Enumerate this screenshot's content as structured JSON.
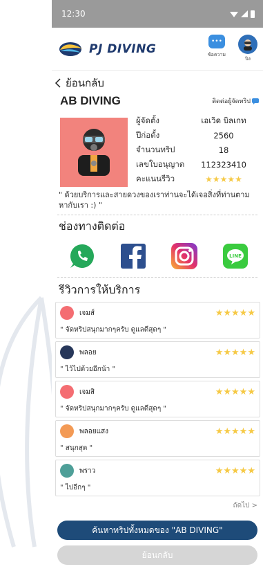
{
  "status": {
    "time": "12:30"
  },
  "app": {
    "brand": "PJ DIVING"
  },
  "header_actions": {
    "messages": "ข้อความ",
    "profile": "ปิง"
  },
  "nav": {
    "back": "ย้อนกลับ"
  },
  "company": {
    "name": "AB DIVING",
    "contact_org": "ติดต่อผู้จัดทริป",
    "fields": [
      {
        "label": "ผู้จัดตั้ง",
        "value": "เอเวิด บิลเกท"
      },
      {
        "label": "ปีก่อตั้ง",
        "value": "2560"
      },
      {
        "label": "จำนวนทริป",
        "value": "18"
      },
      {
        "label": "เลขใบอนุญาต",
        "value": "112323410"
      },
      {
        "label": "คะแนนรีวิว",
        "value": "★★★★★"
      }
    ],
    "quote": "\" ด้วยบริการและสายดวงของเราท่านจะได้เจอสิ่งที่ท่านตามหากับเรา :) \""
  },
  "contact_section": {
    "title": "ช่องทางติดต่อ",
    "channels": [
      "whatsapp",
      "facebook",
      "instagram",
      "line"
    ]
  },
  "reviews_section": {
    "title": "รีวิวการให้บริการ",
    "items": [
      {
        "name": "เจมส์",
        "text": "\" จัดทริปสนุกมากๆครับ ดูแลดีสุดๆ \"",
        "stars": "★★★★★",
        "color": "#f46d72"
      },
      {
        "name": "พลอย",
        "text": "\" ไว้ไปด้วยอีกน้า \"",
        "stars": "★★★★★",
        "color": "#27375a"
      },
      {
        "name": "เจมสิ",
        "text": "\" จัดทริปสนุกมากๆครับ ดูแลดีสุดๆ \"",
        "stars": "★★★★★",
        "color": "#f46d72"
      },
      {
        "name": "พลอยแสง",
        "text": "\" สนุกสุด \"",
        "stars": "★★★★★",
        "color": "#f39a55"
      },
      {
        "name": "พราว",
        "text": "\" ไปอีกๆ \"",
        "stars": "★★★★★",
        "color": "#4e9f98"
      }
    ],
    "next": "ถัดไป >"
  },
  "buttons": {
    "search_all": "ค้นหาทริปทั้งหมดของ \"AB DIVING\"",
    "back": "ย้อนกลับ"
  },
  "colors": {
    "primary": "#1e4b79",
    "accent_star": "#f6c945",
    "profile_bg": "#f2837d",
    "statusbar": "#9a9a9a"
  }
}
